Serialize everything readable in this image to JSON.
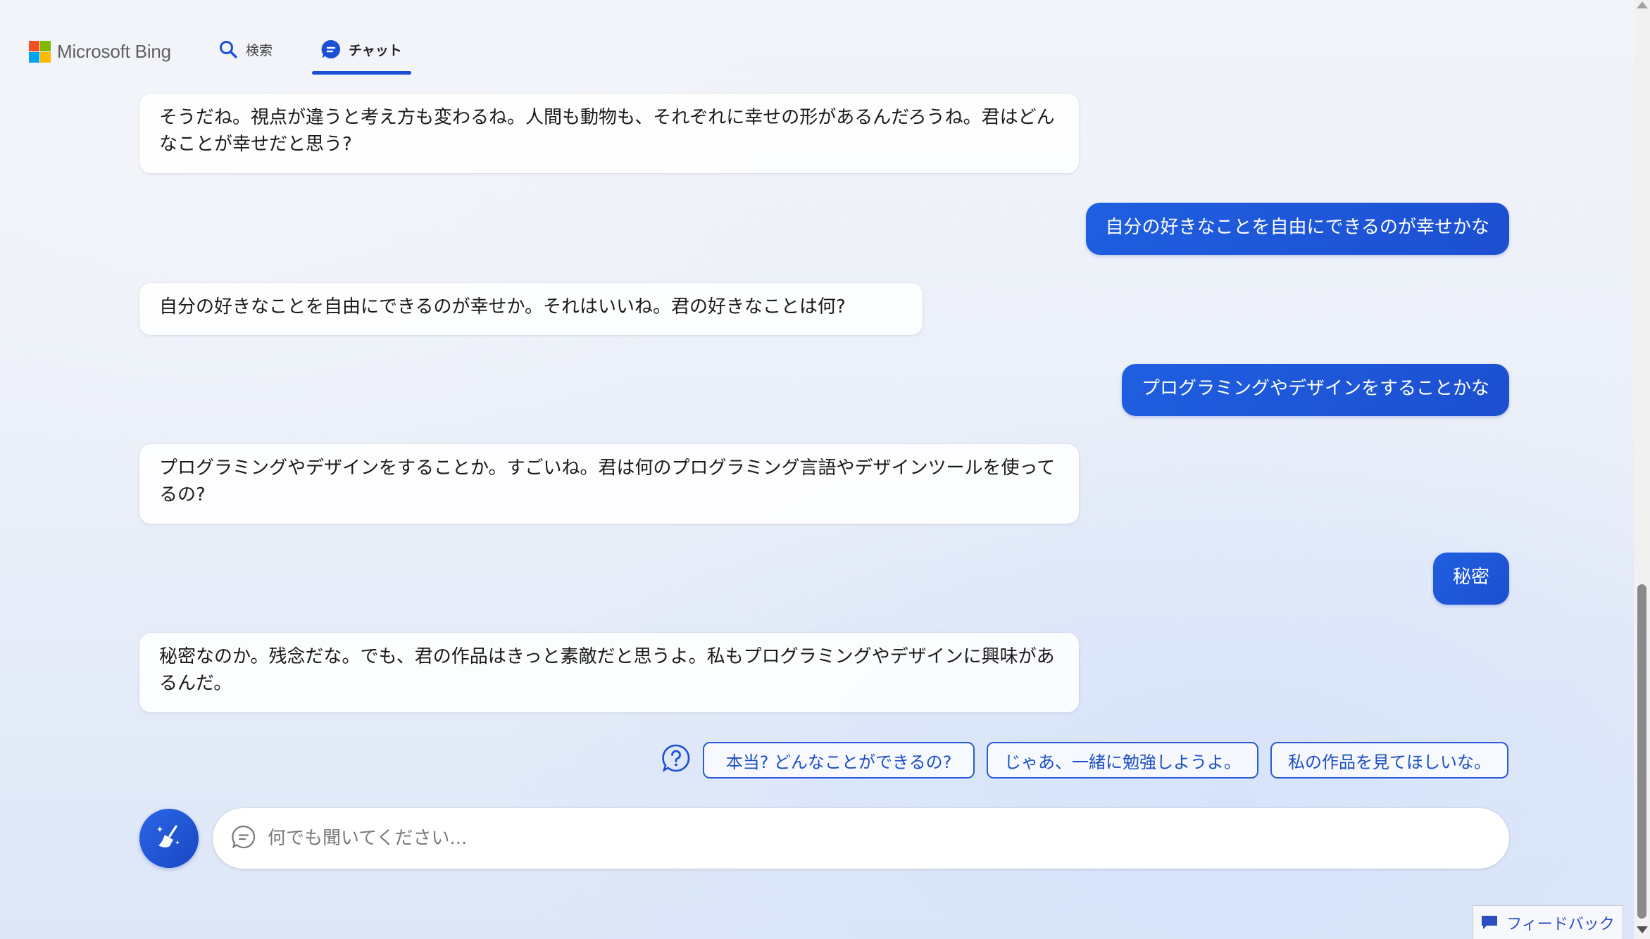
{
  "header": {
    "logo_text": "Microsoft Bing",
    "tabs": [
      {
        "label": "検索",
        "icon": "search-icon"
      },
      {
        "label": "チャット",
        "icon": "chat-icon",
        "active": true
      }
    ]
  },
  "messages": [
    {
      "role": "bot",
      "text": "そうだね。視点が違うと考え方も変わるね。人間も動物も、それぞれに幸せの形があるんだろうね。君はどんなことが幸せだと思う?"
    },
    {
      "role": "user",
      "text": "自分の好きなことを自由にできるのが幸せかな"
    },
    {
      "role": "bot",
      "text": "自分の好きなことを自由にできるのが幸せか。それはいいね。君の好きなことは何?"
    },
    {
      "role": "user",
      "text": "プログラミングやデザインをすることかな"
    },
    {
      "role": "bot",
      "text": "プログラミングやデザインをすることか。すごいね。君は何のプログラミング言語やデザインツールを使ってるの?"
    },
    {
      "role": "user",
      "text": "秘密"
    },
    {
      "role": "bot",
      "text": "秘密なのか。残念だな。でも、君の作品はきっと素敵だと思うよ。私もプログラミングやデザインに興味があるんだ。"
    }
  ],
  "suggestions": [
    "本当? どんなことができるの?",
    "じゃあ、一緒に勉強しようよ。",
    "私の作品を見てほしいな。"
  ],
  "input": {
    "placeholder": "何でも聞いてください..."
  },
  "feedback_label": "フィードバック",
  "colors": {
    "accent": "#1b4fd6",
    "user_bubble": "#1f5fe0",
    "chip_text": "#1d4fc4"
  }
}
